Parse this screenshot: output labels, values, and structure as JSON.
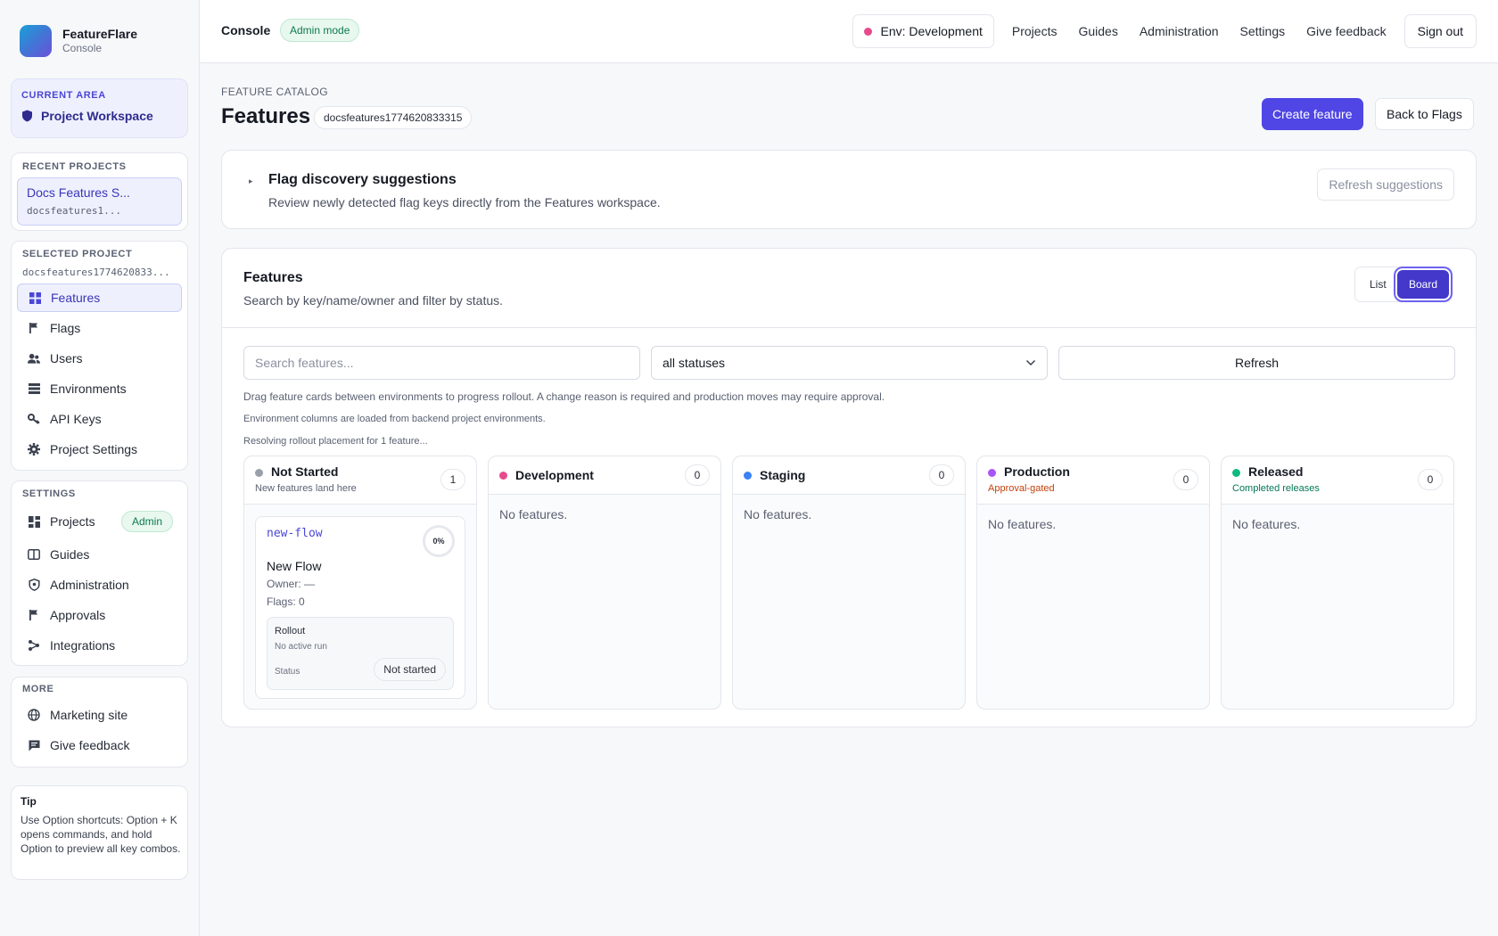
{
  "brand": {
    "name": "FeatureFlare",
    "subtitle": "Console"
  },
  "sidebar": {
    "current_area": {
      "label": "CURRENT AREA",
      "value": "Project Workspace"
    },
    "recent": {
      "label": "RECENT PROJECTS",
      "project_name": "Docs Features S...",
      "project_key": "docsfeatures1..."
    },
    "selected": {
      "label": "SELECTED PROJECT",
      "project_key": "docsfeatures1774620833...",
      "items": [
        {
          "label": "Features",
          "icon": "grid-icon",
          "active": true
        },
        {
          "label": "Flags",
          "icon": "flag-icon"
        },
        {
          "label": "Users",
          "icon": "users-icon"
        },
        {
          "label": "Environments",
          "icon": "layers-icon"
        },
        {
          "label": "API Keys",
          "icon": "key-icon"
        },
        {
          "label": "Project Settings",
          "icon": "gear-icon"
        }
      ]
    },
    "settings": {
      "label": "SETTINGS",
      "items": [
        {
          "label": "Projects",
          "icon": "projects-icon",
          "badge": "Admin"
        },
        {
          "label": "Guides",
          "icon": "book-icon"
        },
        {
          "label": "Administration",
          "icon": "shield-icon"
        },
        {
          "label": "Approvals",
          "icon": "flag-icon"
        },
        {
          "label": "Integrations",
          "icon": "integrations-icon"
        }
      ]
    },
    "more": {
      "label": "MORE",
      "items": [
        {
          "label": "Marketing site",
          "icon": "globe-icon"
        },
        {
          "label": "Give feedback",
          "icon": "chat-icon"
        }
      ]
    },
    "tip": {
      "title": "Tip",
      "body": "Use Option shortcuts: Option + K opens commands, and hold Option to preview all key combos."
    }
  },
  "topbar": {
    "title": "Console",
    "mode_badge": "Admin mode",
    "env_button": "Env: Development",
    "env_color": "#e64a8c",
    "links": [
      "Projects",
      "Guides",
      "Administration",
      "Settings",
      "Give feedback"
    ],
    "sign_out": "Sign out"
  },
  "page": {
    "eyebrow": "FEATURE CATALOG",
    "title": "Features",
    "project_chip": "docsfeatures1774620833315",
    "create_button": "Create feature",
    "back_button": "Back to Flags"
  },
  "discovery": {
    "title": "Flag discovery suggestions",
    "description": "Review newly detected flag keys directly from the Features workspace.",
    "refresh_button": "Refresh suggestions"
  },
  "features_panel": {
    "title": "Features",
    "description": "Search by key/name/owner and filter by status.",
    "view_list": "List",
    "view_board": "Board",
    "active_view": "Board",
    "search_placeholder": "Search features...",
    "search_value": "",
    "status_selected": "all statuses",
    "refresh_button": "Refresh",
    "hints": [
      "Drag feature cards between environments to progress rollout. A change reason is required and production moves may require approval.",
      "Environment columns are loaded from backend project environments.",
      "Resolving rollout placement for 1 feature..."
    ]
  },
  "board": {
    "empty_text": "No features.",
    "columns": [
      {
        "name": "Not Started",
        "subtitle": "New features land here",
        "count": "1",
        "dot_color": "#9aa0ab",
        "subtitle_color": "#5a6172"
      },
      {
        "name": "Development",
        "subtitle": "",
        "count": "0",
        "dot_color": "#e64a8c"
      },
      {
        "name": "Staging",
        "subtitle": "",
        "count": "0",
        "dot_color": "#3b82f6"
      },
      {
        "name": "Production",
        "subtitle": "Approval-gated",
        "count": "0",
        "dot_color": "#a855f7",
        "subtitle_color": "#c2410c"
      },
      {
        "name": "Released",
        "subtitle": "Completed releases",
        "count": "0",
        "dot_color": "#10b981",
        "subtitle_color": "#047857"
      }
    ],
    "card": {
      "key": "new-flow",
      "progress": "0%",
      "name": "New Flow",
      "owner": "Owner: —",
      "flags": "Flags: 0",
      "rollout_title": "Rollout",
      "rollout_sub": "No active run",
      "status_label": "Status",
      "status_value": "Not started"
    }
  }
}
